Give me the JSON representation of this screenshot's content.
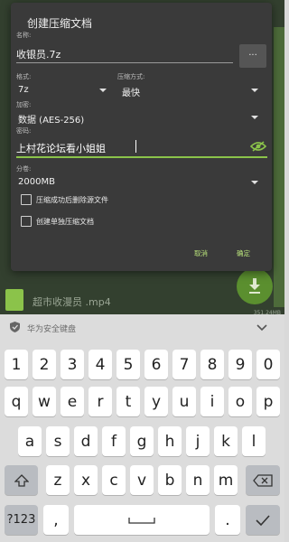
{
  "background": {
    "file_name": "超市收漫员 .mp4",
    "file_size": "351.24MB",
    "fab_icon": "download-icon"
  },
  "dialog": {
    "title": "创建压缩文档",
    "name_label": "名称:",
    "name_value": "收银员.7z",
    "browse_button": "...",
    "format_label": "格式:",
    "format_value": "7z",
    "compression_label": "压缩方式:",
    "compression_value": "最快",
    "encryption_label": "加密:",
    "encryption_value": "数据 (AES-256)",
    "password_label": "密码:",
    "password_value": "上村花论坛看小姐姐",
    "split_label": "分卷:",
    "split_value": "2000MB",
    "checkbox_delete": "压缩成功后删除源文件",
    "checkbox_separate": "创建单独压缩文档",
    "cancel": "取消",
    "ok": "确定",
    "accent_color": "#b7e07a"
  },
  "keyboard": {
    "title": "华为安全键盘",
    "row1": [
      "1",
      "2",
      "3",
      "4",
      "5",
      "6",
      "7",
      "8",
      "9",
      "0"
    ],
    "row2": [
      "q",
      "w",
      "e",
      "r",
      "t",
      "y",
      "u",
      "i",
      "o",
      "p"
    ],
    "row3": [
      "a",
      "s",
      "d",
      "f",
      "g",
      "h",
      "j",
      "k",
      "l"
    ],
    "row4": [
      "z",
      "x",
      "c",
      "v",
      "b",
      "n",
      "m"
    ],
    "symbols_key": "?123",
    "comma_key": ",",
    "period_key": "."
  }
}
